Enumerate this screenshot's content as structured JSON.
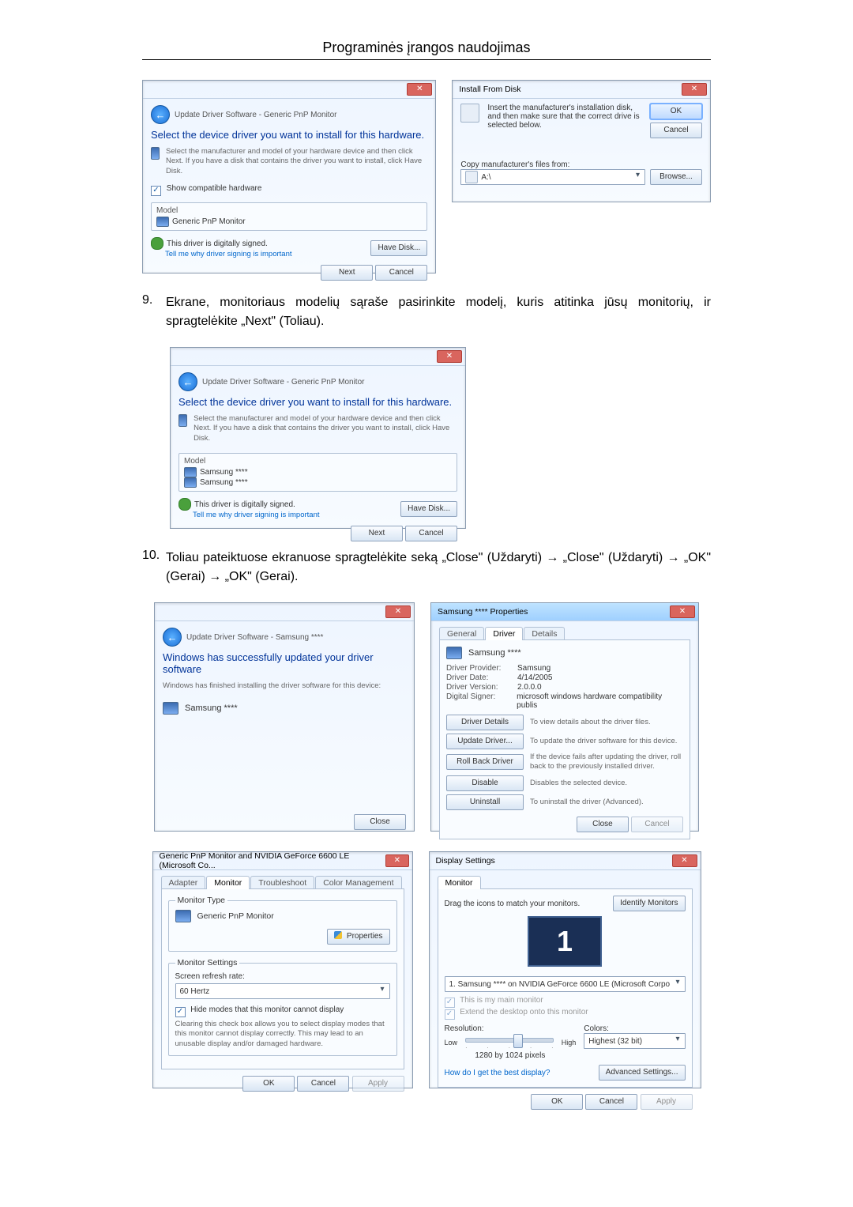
{
  "page_title": "Programinės įrangos naudojimas",
  "step9": {
    "num": "9.",
    "text": "Ekrane, monitoriaus modelių sąraše pasirinkite modelį, kuris atitinka jūsų monitorių, ir spragtelėkite „Next\" (Toliau)."
  },
  "step10": {
    "num": "10.",
    "text": "Toliau pateiktuose ekranuose spragtelėkite seką „Close\" (Uždaryti) → „Close\" (Uždaryti) → „OK\" (Gerai) → „OK\" (Gerai)."
  },
  "dlg_update1": {
    "breadcrumb": "Update Driver Software - Generic PnP Monitor",
    "heading": "Select the device driver you want to install for this hardware.",
    "subtext": "Select the manufacturer and model of your hardware device and then click Next. If you have a disk that contains the driver you want to install, click Have Disk.",
    "chk_compat": "Show compatible hardware",
    "col_model": "Model",
    "model_item": "Generic PnP Monitor",
    "signed": "This driver is digitally signed.",
    "tellme": "Tell me why driver signing is important",
    "have_disk": "Have Disk...",
    "next": "Next",
    "cancel": "Cancel"
  },
  "dlg_install_from_disk": {
    "title": "Install From Disk",
    "instr": "Insert the manufacturer's installation disk, and then make sure that the correct drive is selected below.",
    "ok": "OK",
    "cancel": "Cancel",
    "copy": "Copy manufacturer's files from:",
    "path": "A:\\",
    "browse": "Browse..."
  },
  "dlg_update2": {
    "breadcrumb": "Update Driver Software - Generic PnP Monitor",
    "heading": "Select the device driver you want to install for this hardware.",
    "subtext": "Select the manufacturer and model of your hardware device and then click Next. If you have a disk that contains the driver you want to install, click Have Disk.",
    "col_model": "Model",
    "model_item1": "Samsung ****",
    "model_item2": "Samsung ****",
    "signed": "This driver is digitally signed.",
    "tellme": "Tell me why driver signing is important",
    "have_disk": "Have Disk...",
    "next": "Next",
    "cancel": "Cancel"
  },
  "dlg_updated": {
    "breadcrumb": "Update Driver Software - Samsung ****",
    "heading": "Windows has successfully updated your driver software",
    "subtext": "Windows has finished installing the driver software for this device:",
    "device": "Samsung ****",
    "close": "Close"
  },
  "dlg_props": {
    "title": "Samsung **** Properties",
    "tabs": [
      "General",
      "Driver",
      "Details"
    ],
    "device": "Samsung ****",
    "rows": {
      "Driver Provider:": "Samsung",
      "Driver Date:": "4/14/2005",
      "Driver Version:": "2.0.0.0",
      "Digital Signer:": "microsoft windows hardware compatibility publis"
    },
    "btn_details": "Driver Details",
    "desc_details": "To view details about the driver files.",
    "btn_update": "Update Driver...",
    "desc_update": "To update the driver software for this device.",
    "btn_rollback": "Roll Back Driver",
    "desc_rollback": "If the device fails after updating the driver, roll back to the previously installed driver.",
    "btn_disable": "Disable",
    "desc_disable": "Disables the selected device.",
    "btn_uninstall": "Uninstall",
    "desc_uninstall": "To uninstall the driver (Advanced).",
    "close": "Close",
    "cancel": "Cancel"
  },
  "dlg_monprops": {
    "title": "Generic PnP Monitor and NVIDIA GeForce 6600 LE (Microsoft Co...",
    "tabs": [
      "Adapter",
      "Monitor",
      "Troubleshoot",
      "Color Management"
    ],
    "grp_type": "Monitor Type",
    "type_val": "Generic PnP Monitor",
    "btn_props": "Properties",
    "grp_settings": "Monitor Settings",
    "lbl_refresh": "Screen refresh rate:",
    "refresh_val": "60 Hertz",
    "chk_hide": "Hide modes that this monitor cannot display",
    "hide_desc": "Clearing this check box allows you to select display modes that this monitor cannot display correctly. This may lead to an unusable display and/or damaged hardware.",
    "ok": "OK",
    "cancel": "Cancel",
    "apply": "Apply"
  },
  "dlg_display": {
    "title": "Display Settings",
    "tab": "Monitor",
    "drag": "Drag the icons to match your monitors.",
    "identify": "Identify Monitors",
    "big": "1",
    "sel": "1. Samsung **** on NVIDIA GeForce 6600 LE (Microsoft Corpo",
    "chk_main": "This is my main monitor",
    "chk_extend": "Extend the desktop onto this monitor",
    "lbl_res": "Resolution:",
    "low": "Low",
    "high": "High",
    "res_val": "1280 by 1024 pixels",
    "lbl_colors": "Colors:",
    "colors_val": "Highest (32 bit)",
    "link_best": "How do I get the best display?",
    "advanced": "Advanced Settings...",
    "ok": "OK",
    "cancel": "Cancel",
    "apply": "Apply"
  }
}
